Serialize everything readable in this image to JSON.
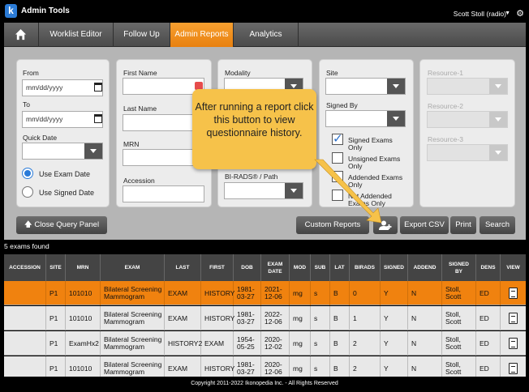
{
  "app": {
    "logo": "k",
    "title": "Admin Tools",
    "user": "Scott Stoll (radio)"
  },
  "nav": {
    "items": [
      "Worklist Editor",
      "Follow Up",
      "Admin Reports",
      "Analytics"
    ],
    "active": "Admin Reports"
  },
  "query": {
    "from_label": "From",
    "from_placeholder": "mm/dd/yyyy",
    "to_label": "To",
    "to_placeholder": "mm/dd/yyyy",
    "quick_date_label": "Quick Date",
    "use_exam_date": "Use Exam Date",
    "use_signed_date": "Use Signed Date",
    "first_name_label": "First Name",
    "last_name_label": "Last Name",
    "mrn_label": "MRN",
    "accession_label": "Accession",
    "modality_label": "Modality",
    "birads_label": "BI-RADS® / Path",
    "site_label": "Site",
    "signed_by_label": "Signed By",
    "signed_exams": "Signed Exams Only",
    "unsigned_exams": "Unsigned Exams Only",
    "addended_exams": "Addended Exams Only",
    "not_addended": "Not Addended Exams Only",
    "resource1": "Resource-1",
    "resource2": "Resource-2",
    "resource3": "Resource-3"
  },
  "buttons": {
    "close_query": "Close Query Panel",
    "custom_reports": "Custom Reports",
    "export_csv": "Export CSV",
    "print": "Print",
    "search": "Search"
  },
  "callout": {
    "text": "After running a report click this button to view questionnaire history."
  },
  "results": {
    "count": "5 exams found",
    "headers": [
      "ACCESSION",
      "SITE",
      "MRN",
      "EXAM",
      "LAST",
      "FIRST",
      "DOB",
      "EXAM DATE",
      "MOD",
      "SUB",
      "LAT",
      "BIRADS",
      "SIGNED",
      "ADDEND",
      "SIGNED BY",
      "DENS",
      "VIEW"
    ],
    "rows": [
      {
        "accession": "",
        "site": "P1",
        "mrn": "101010",
        "exam": "Bilateral Screening Mammogram",
        "last": "EXAM",
        "first": "HISTORY",
        "dob": "1981-03-27",
        "exam_date": "2021-12-06",
        "mod": "mg",
        "sub": "s",
        "lat": "B",
        "birads": "0",
        "signed": "Y",
        "addend": "N",
        "signed_by": "Stoll, Scott",
        "dens": "ED"
      },
      {
        "accession": "",
        "site": "P1",
        "mrn": "101010",
        "exam": "Bilateral Screening Mammogram",
        "last": "EXAM",
        "first": "HISTORY",
        "dob": "1981-03-27",
        "exam_date": "2022-12-06",
        "mod": "mg",
        "sub": "s",
        "lat": "B",
        "birads": "1",
        "signed": "Y",
        "addend": "N",
        "signed_by": "Stoll, Scott",
        "dens": "ED"
      },
      {
        "accession": "",
        "site": "P1",
        "mrn": "ExamHx2",
        "exam": "Bilateral Screening Mammogram",
        "last": "HISTORY2",
        "first": "EXAM",
        "dob": "1954-05-25",
        "exam_date": "2020-12-02",
        "mod": "mg",
        "sub": "s",
        "lat": "B",
        "birads": "2",
        "signed": "Y",
        "addend": "N",
        "signed_by": "Stoll, Scott",
        "dens": "ED"
      },
      {
        "accession": "",
        "site": "P1",
        "mrn": "101010",
        "exam": "Bilateral Screening Mammogram",
        "last": "EXAM",
        "first": "HISTORY",
        "dob": "1981-03-27",
        "exam_date": "2020-12-06",
        "mod": "mg",
        "sub": "s",
        "lat": "B",
        "birads": "2",
        "signed": "Y",
        "addend": "N",
        "signed_by": "Stoll, Scott",
        "dens": "ED"
      }
    ]
  },
  "footer": "Copyright 2011-2022 Ikonopedia Inc. - All Rights Reserved",
  "colors": {
    "accent": "#f0820f",
    "callout": "#f6c24a",
    "radio_on": "#2a7bd8"
  }
}
